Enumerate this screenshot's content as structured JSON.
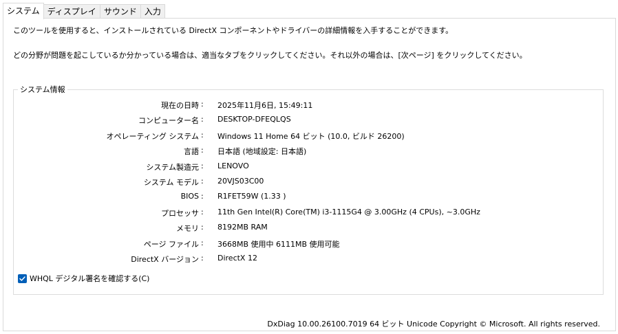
{
  "tabs": [
    {
      "label": "システム",
      "active": true
    },
    {
      "label": "ディスプレイ",
      "active": false
    },
    {
      "label": "サウンド",
      "active": false
    },
    {
      "label": "入力",
      "active": false
    }
  ],
  "intro": {
    "line1": "このツールを使用すると、インストールされている DirectX コンポーネントやドライバーの詳細情報を入手することができます。",
    "line2": "どの分野が問題を起こしているか分かっている場合は、適当なタブをクリックしてください。それ以外の場合は、[次ページ] をクリックしてください。"
  },
  "system_info": {
    "title": "システム情報",
    "separator": ":",
    "rows": [
      {
        "label": "現在の日時",
        "value": "2025年11月6日, 15:49:11"
      },
      {
        "label": "コンピューター名",
        "value": "DESKTOP-DFEQLQS"
      },
      {
        "label": "オペレーティング システム",
        "value": "Windows 11 Home 64 ビット (10.0, ビルド 26200)"
      },
      {
        "label": "言語",
        "value": "日本語 (地域設定: 日本語)"
      },
      {
        "label": "システム製造元",
        "value": "LENOVO"
      },
      {
        "label": "システム モデル",
        "value": "20VJS03C00"
      },
      {
        "label": "BIOS",
        "value": "R1FET59W (1.33 )"
      },
      {
        "label": "プロセッサ",
        "value": "11th Gen Intel(R) Core(TM) i3-1115G4 @ 3.00GHz (4 CPUs), ~3.0GHz"
      },
      {
        "label": "メモリ",
        "value": "8192MB RAM"
      },
      {
        "label": "ページ ファイル",
        "value": "3668MB 使用中 6111MB 使用可能"
      },
      {
        "label": "DirectX バージョン",
        "value": "DirectX 12"
      }
    ]
  },
  "whql": {
    "label": "WHQL デジタル署名を確認する(C)",
    "checked": true,
    "check_color": "#005fb8"
  },
  "footer": {
    "text": "DxDiag 10.00.26100.7019 64 ビット Unicode  Copyright © Microsoft. All rights reserved."
  }
}
